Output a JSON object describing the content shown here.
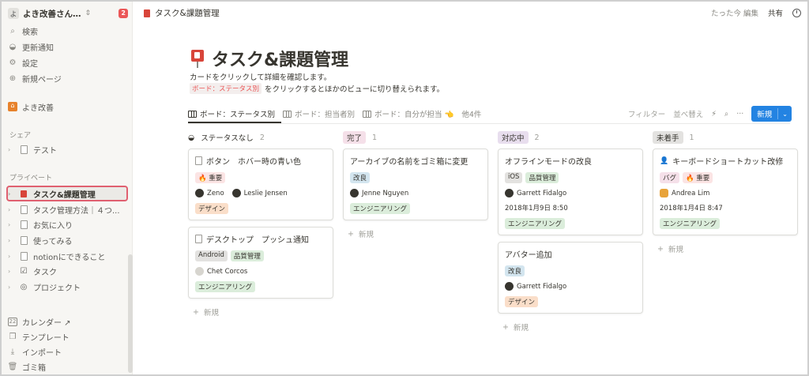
{
  "sidebar": {
    "workspace": {
      "avatar": "よ",
      "name": "よき改善さん…",
      "caret": "⇕",
      "badge": "2"
    },
    "top_items": [
      {
        "icon": "🔍",
        "label": "検索"
      },
      {
        "icon": "⊝",
        "label": "更新通知"
      },
      {
        "icon": "⚙",
        "label": "設定"
      },
      {
        "icon": "⊕",
        "label": "新規ページ"
      }
    ],
    "home_item": {
      "label": "よき改善"
    },
    "share_section": "シェア",
    "share_items": [
      {
        "label": "テスト"
      }
    ],
    "private_section": "プライベート",
    "private_items": [
      {
        "label": "タスク&課題管理"
      },
      {
        "label": "タスク管理方法｜４つ..."
      },
      {
        "label": "お気に入り"
      },
      {
        "label": "使ってみる"
      },
      {
        "label": "notionにできること"
      },
      {
        "label": "タスク"
      },
      {
        "label": "プロジェクト"
      }
    ],
    "bottom_items": [
      {
        "label": "カレンダー ↗"
      },
      {
        "label": "テンプレート"
      },
      {
        "label": "インポート"
      },
      {
        "label": "ゴミ箱"
      }
    ]
  },
  "topbar": {
    "breadcrumb": "タスク&課題管理",
    "edited": "たった今 編集",
    "share": "共有"
  },
  "page": {
    "title": "タスク&課題管理",
    "desc1": "カードをクリックして詳細を確認します。",
    "desc2_code": "ボード：ステータス別",
    "desc2_text": "をクリックするとほかのビューに切り替えられます。"
  },
  "views": {
    "tabs": [
      "ボード：ステータス別",
      "ボード：担当者別",
      "ボード：自分が担当 👈"
    ],
    "more": "他4件",
    "filter": "フィルター",
    "sort": "並べ替え",
    "new": "新規"
  },
  "colors": {
    "accent": "#2383e2",
    "highlight_border": "#e06070"
  },
  "board": {
    "add_label": "新規",
    "columns": [
      {
        "name": "ステータスなし",
        "count": "2",
        "tag_bg": "transparent",
        "cards": [
          {
            "title": "ボタン　ホバー時の青い色",
            "tags": [
              {
                "text": "🔥 重要",
                "bg": "#fbe4e4"
              }
            ],
            "people": [
              "Zeno",
              "Leslie Jensen"
            ],
            "date": "",
            "category": {
              "text": "デザイン",
              "bg": "#fadec9"
            }
          },
          {
            "title": "デスクトップ　プッシュ通知",
            "tags": [
              {
                "text": "Android",
                "bg": "#e3e2e0"
              },
              {
                "text": "品質管理",
                "bg": "#dbeddb"
              }
            ],
            "people": [
              "Chet Corcos"
            ],
            "date": "",
            "category": {
              "text": "エンジニアリング",
              "bg": "#dbeddb"
            }
          }
        ]
      },
      {
        "name": "完了",
        "count": "1",
        "tag_bg": "#f5e0e9",
        "cards": [
          {
            "title": "アーカイブの名前をゴミ箱に変更",
            "tags": [
              {
                "text": "改良",
                "bg": "#d3e5ef"
              }
            ],
            "people": [
              "Jenne Nguyen"
            ],
            "date": "",
            "category": {
              "text": "エンジニアリング",
              "bg": "#dbeddb"
            }
          }
        ]
      },
      {
        "name": "対応中",
        "count": "2",
        "tag_bg": "#e8deee",
        "cards": [
          {
            "title": "オフラインモードの改良",
            "tags": [
              {
                "text": "iOS",
                "bg": "#e3e2e0"
              },
              {
                "text": "品質管理",
                "bg": "#dbeddb"
              }
            ],
            "people": [
              "Garrett Fidalgo"
            ],
            "date": "2018年1月9日 8:50",
            "category": {
              "text": "エンジニアリング",
              "bg": "#dbeddb"
            }
          },
          {
            "title": "アバター追加",
            "tags": [
              {
                "text": "改良",
                "bg": "#d3e5ef"
              }
            ],
            "people": [
              "Garrett Fidalgo"
            ],
            "date": "",
            "category": {
              "text": "デザイン",
              "bg": "#fadec9"
            }
          }
        ]
      },
      {
        "name": "未着手",
        "count": "1",
        "tag_bg": "#e3e2e0",
        "cards": [
          {
            "title": "キーボードショートカット改修",
            "tags": [
              {
                "text": "バグ",
                "bg": "#f5e0e9"
              },
              {
                "text": "🔥 重要",
                "bg": "#fbe4e4"
              }
            ],
            "people": [
              "Andrea Lim"
            ],
            "date": "2018年1月4日 8:47",
            "category": {
              "text": "エンジニアリング",
              "bg": "#dbeddb"
            }
          }
        ]
      }
    ]
  }
}
